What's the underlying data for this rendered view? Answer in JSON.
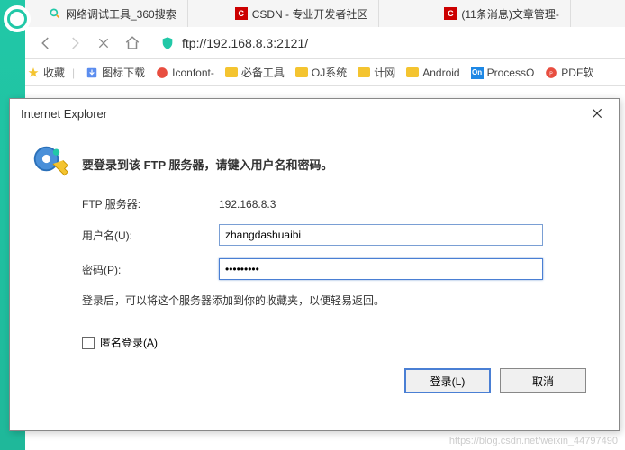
{
  "tabs": [
    {
      "label": "网络调试工具_360搜索"
    },
    {
      "label": "CSDN - 专业开发者社区",
      "iconColor": "#c00"
    },
    {
      "label": "(11条消息)文章管理-",
      "iconColor": "#c00"
    }
  ],
  "nav": {
    "url": "ftp://192.168.8.3:2121/"
  },
  "bookmarks": {
    "fav": "收藏",
    "items": [
      {
        "label": "图标下载",
        "type": "ext"
      },
      {
        "label": "Iconfont-",
        "type": "icon"
      },
      {
        "label": "必备工具",
        "type": "folder"
      },
      {
        "label": "OJ系统",
        "type": "folder"
      },
      {
        "label": "计网",
        "type": "folder"
      },
      {
        "label": "Android",
        "type": "folder"
      },
      {
        "label": "ProcessO",
        "type": "on"
      },
      {
        "label": "PDF软",
        "type": "pdf"
      }
    ]
  },
  "dialog": {
    "title": "Internet Explorer",
    "heading": "要登录到该 FTP 服务器，请键入用户名和密码。",
    "serverLabel": "FTP 服务器:",
    "serverValue": "192.168.8.3",
    "userLabel": "用户名(U):",
    "userValue": "zhangdashuaibi",
    "passLabel": "密码(P):",
    "passValue": "•••••••••",
    "info": "登录后，可以将这个服务器添加到你的收藏夹，以便轻易返回。",
    "anon": "匿名登录(A)",
    "loginBtn": "登录(L)",
    "cancelBtn": "取消"
  },
  "watermark": "https://blog.csdn.net/weixin_44797490"
}
